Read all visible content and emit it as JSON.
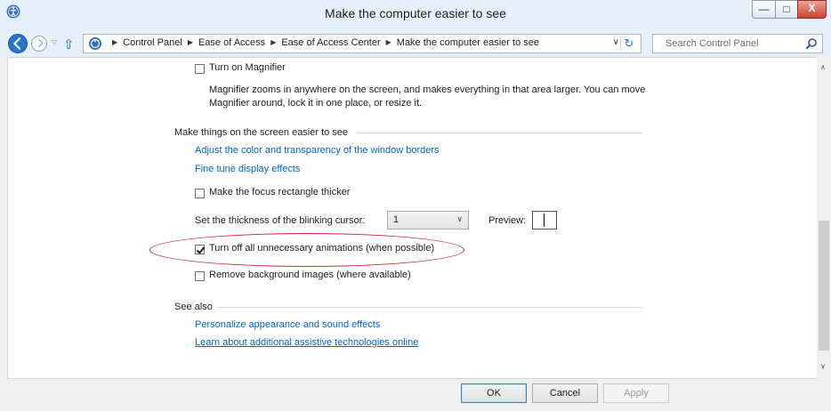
{
  "window": {
    "title": "Make the computer easier to see",
    "min_glyph": "—",
    "max_glyph": "□",
    "close_glyph": "X"
  },
  "nav": {
    "recent_glyph": "▽",
    "up_glyph": "⇧",
    "breadcrumbs": [
      "Control Panel",
      "Ease of Access",
      "Ease of Access Center",
      "Make the computer easier to see"
    ],
    "crumb_sep": "▶",
    "dropdown_glyph": "∨",
    "refresh_glyph": "↻",
    "search_placeholder": "Search Control Panel"
  },
  "magnifier": {
    "checkbox_label": "Turn on Magnifier",
    "checked": false,
    "description_line1": "Magnifier zooms in anywhere on the screen, and makes everything in that area larger. You can move",
    "description_line2": "Magnifier around, lock it in one place, or resize it."
  },
  "easier_section": {
    "heading": "Make things on the screen easier to see",
    "link_borders": "Adjust the color and transparency of the window borders",
    "link_display": "Fine tune display effects",
    "focus_rect_label": "Make the focus rectangle thicker",
    "focus_rect_checked": false,
    "cursor_label": "Set the thickness of the blinking cursor:",
    "cursor_value": "1",
    "preview_label": "Preview:",
    "animations_label": "Turn off all unnecessary animations (when possible)",
    "animations_checked": true,
    "bg_images_label": "Remove background images (where available)",
    "bg_images_checked": false
  },
  "see_also": {
    "heading": "See also",
    "link_personalize": "Personalize appearance and sound effects",
    "link_assistive": "Learn about additional assistive technologies online"
  },
  "scroll": {
    "up_glyph": "∧",
    "down_glyph": "∨"
  },
  "footer": {
    "ok": "OK",
    "cancel": "Cancel",
    "apply": "Apply"
  },
  "colors": {
    "link": "#0066cc",
    "highlight_ellipse": "#d0262e",
    "titlebar": "#e6f0fa"
  }
}
